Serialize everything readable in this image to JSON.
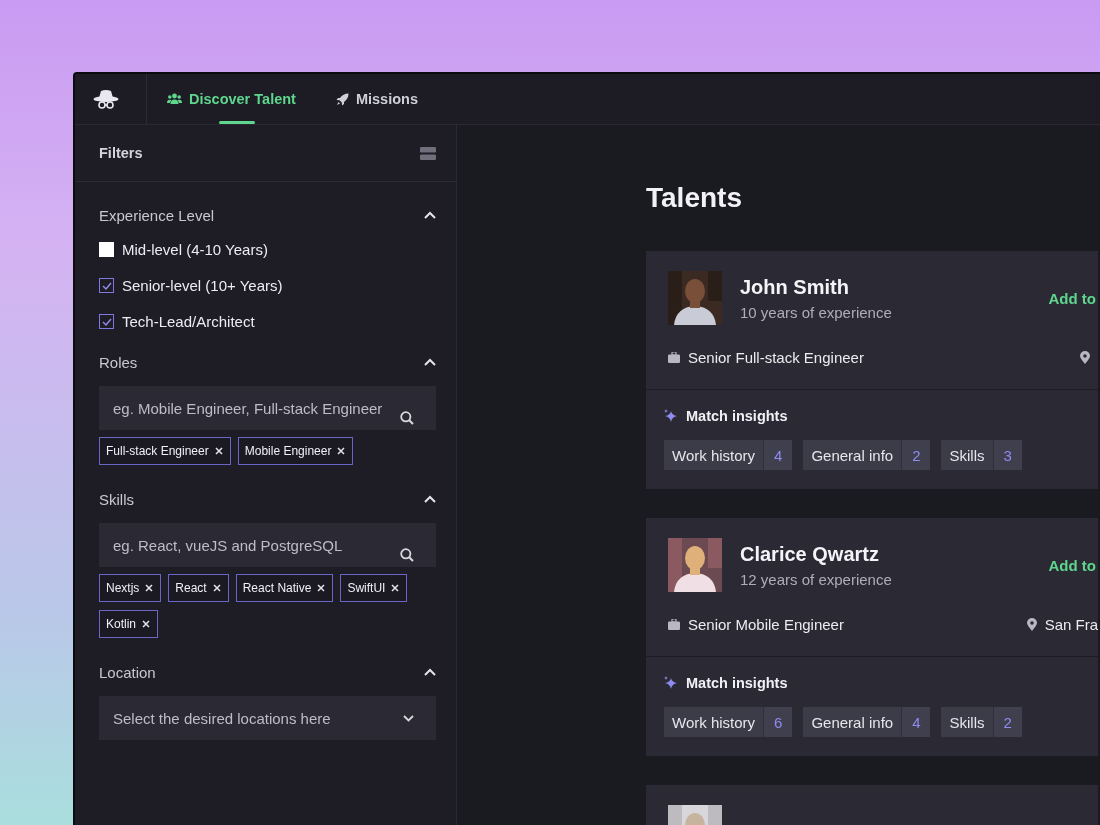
{
  "nav": {
    "tabs": [
      {
        "label": "Discover Talent",
        "selected": true
      },
      {
        "label": "Missions",
        "selected": false
      }
    ]
  },
  "filters": {
    "title": "Filters",
    "sections": [
      {
        "title": "Experience Level",
        "expanded": true,
        "kind": "checkboxes",
        "options": [
          {
            "label": "Mid-level (4-10 Years)",
            "checked": false
          },
          {
            "label": "Senior-level (10+ Years)",
            "checked": true
          },
          {
            "label": "Tech-Lead/Architect",
            "checked": true
          }
        ]
      },
      {
        "title": "Roles",
        "expanded": true,
        "kind": "search",
        "placeholder": "eg. Mobile Engineer, Full-stack Engineer",
        "tags": [
          "Full-stack Engineer",
          "Mobile Engineer"
        ]
      },
      {
        "title": "Skills",
        "expanded": true,
        "kind": "search",
        "placeholder": "eg. React, vueJS and PostgreSQL",
        "tags": [
          "Nextjs",
          "React",
          "React Native",
          "SwiftUI",
          "Kotlin"
        ]
      },
      {
        "title": "Location",
        "expanded": true,
        "kind": "select",
        "placeholder": "Select the desired locations here"
      }
    ]
  },
  "main": {
    "title": "Talents",
    "talents": [
      {
        "kind": "full",
        "name": "John Smith",
        "experience": "10 years of experience",
        "action": "Add to",
        "role": "Senior Full-stack Engineer",
        "insights_title": "Match insights",
        "insights": [
          {
            "label": "Work history",
            "count": "4"
          },
          {
            "label": "General info",
            "count": "2"
          },
          {
            "label": "Skills",
            "count": "3"
          }
        ]
      },
      {
        "kind": "full",
        "name": "Clarice Qwartz",
        "experience": "12 years of experience",
        "action": "Add to",
        "role": "Senior Mobile Engineer",
        "location": "San Fra",
        "insights_title": "Match insights",
        "insights": [
          {
            "label": "Work history",
            "count": "6"
          },
          {
            "label": "General info",
            "count": "4"
          },
          {
            "label": "Skills",
            "count": "2"
          }
        ]
      },
      {
        "kind": "partial"
      }
    ]
  }
}
